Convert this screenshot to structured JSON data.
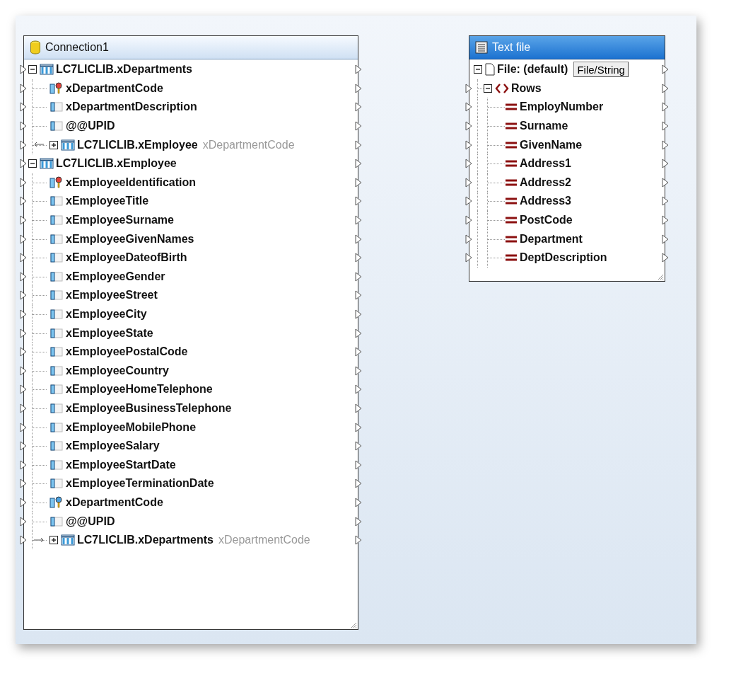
{
  "components": [
    {
      "kind": "database",
      "title": "Connection1",
      "selected": false,
      "nodes": [
        {
          "kind": "table",
          "label": "LC7LICLIB.xDepartments",
          "expanded": true,
          "children": [
            {
              "kind": "primary_key",
              "label": "xDepartmentCode"
            },
            {
              "kind": "column",
              "label": "xDepartmentDescription"
            },
            {
              "kind": "column",
              "label": "@@UPID"
            },
            {
              "kind": "relation",
              "incoming": true,
              "label": "LC7LICLIB.xEmployee",
              "note": "xDepartmentCode",
              "expanded": false
            }
          ]
        },
        {
          "kind": "table",
          "label": "LC7LICLIB.xEmployee",
          "expanded": true,
          "children": [
            {
              "kind": "primary_key",
              "label": "xEmployeeIdentification"
            },
            {
              "kind": "column",
              "label": "xEmployeeTitle"
            },
            {
              "kind": "column",
              "label": "xEmployeeSurname"
            },
            {
              "kind": "column",
              "label": "xEmployeeGivenNames"
            },
            {
              "kind": "column",
              "label": "xEmployeeDateofBirth"
            },
            {
              "kind": "column",
              "label": "xEmployeeGender"
            },
            {
              "kind": "column",
              "label": "xEmployeeStreet"
            },
            {
              "kind": "column",
              "label": "xEmployeeCity"
            },
            {
              "kind": "column",
              "label": "xEmployeeState"
            },
            {
              "kind": "column",
              "label": "xEmployeePostalCode"
            },
            {
              "kind": "column",
              "label": "xEmployeeCountry"
            },
            {
              "kind": "column",
              "label": "xEmployeeHomeTelephone"
            },
            {
              "kind": "column",
              "label": "xEmployeeBusinessTelephone"
            },
            {
              "kind": "column",
              "label": "xEmployeeMobilePhone"
            },
            {
              "kind": "column",
              "label": "xEmployeeSalary"
            },
            {
              "kind": "column",
              "label": "xEmployeeStartDate"
            },
            {
              "kind": "column",
              "label": "xEmployeeTerminationDate"
            },
            {
              "kind": "foreign_key",
              "label": "xDepartmentCode"
            },
            {
              "kind": "column",
              "label": "@@UPID"
            },
            {
              "kind": "relation",
              "incoming": false,
              "label": "LC7LICLIB.xDepartments",
              "note": "xDepartmentCode",
              "expanded": false
            }
          ]
        }
      ]
    },
    {
      "kind": "text",
      "title": "Text file",
      "selected": true,
      "nodes": [
        {
          "kind": "file",
          "label": "File: (default)",
          "button": "File/String",
          "expanded": true,
          "children": [
            {
              "kind": "group",
              "label": "Rows",
              "expanded": true,
              "children": [
                {
                  "kind": "field",
                  "label": "EmployNumber"
                },
                {
                  "kind": "field",
                  "label": "Surname"
                },
                {
                  "kind": "field",
                  "label": "GivenName"
                },
                {
                  "kind": "field",
                  "label": "Address1"
                },
                {
                  "kind": "field",
                  "label": "Address2"
                },
                {
                  "kind": "field",
                  "label": "Address3"
                },
                {
                  "kind": "field",
                  "label": "PostCode"
                },
                {
                  "kind": "field",
                  "label": "Department"
                },
                {
                  "kind": "field",
                  "label": "DeptDescription"
                }
              ]
            }
          ]
        }
      ]
    }
  ]
}
